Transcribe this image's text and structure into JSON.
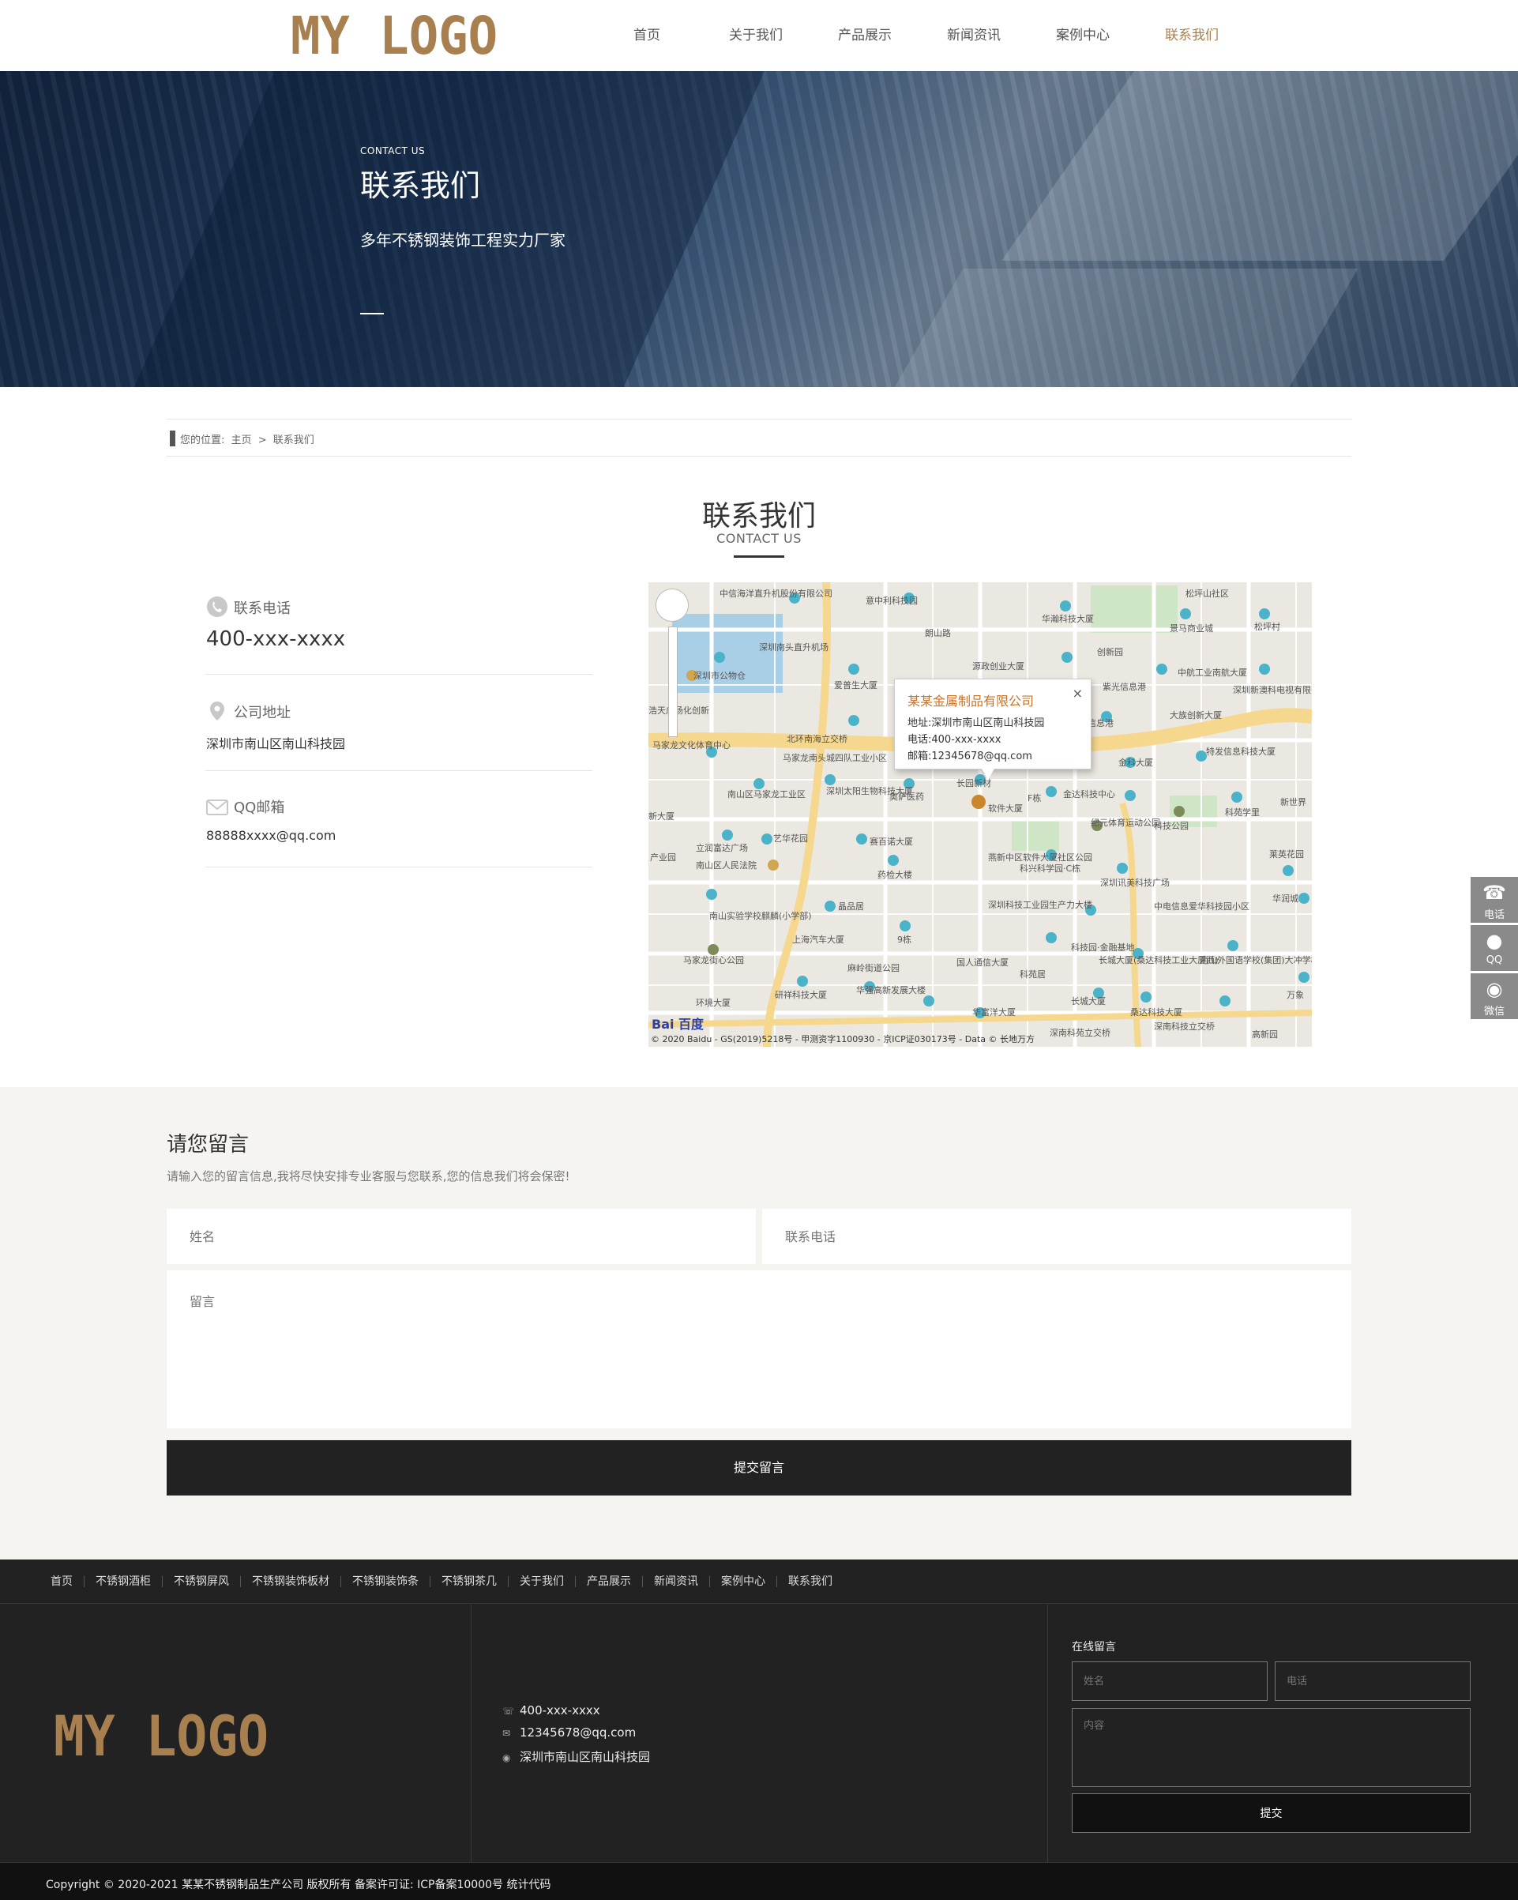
{
  "header": {
    "logo_text": "MY LOGO",
    "nav": [
      {
        "label": "首页"
      },
      {
        "label": "关于我们"
      },
      {
        "label": "产品展示"
      },
      {
        "label": "新闻资讯"
      },
      {
        "label": "案例中心"
      },
      {
        "label": "联系我们",
        "active": true
      }
    ]
  },
  "banner": {
    "en": "CONTACT US",
    "title": "联系我们",
    "subtitle": "多年不锈钢装饰工程实力厂家"
  },
  "breadcrumb": {
    "prefix": "您的位置:",
    "home": "主页",
    "sep": ">",
    "current": "联系我们"
  },
  "section": {
    "title": "联系我们",
    "en": "CONTACT US"
  },
  "contact": {
    "phone_label": "联系电话",
    "phone": "400-xxx-xxxx",
    "address_label": "公司地址",
    "address": "深圳市南山区南山科技园",
    "email_label": "QQ邮箱",
    "email": "88888xxxx@qq.com"
  },
  "map": {
    "popup_title": "某某金属制品有限公司",
    "popup_close": "×",
    "popup_address": "地址:深圳市南山区南山科技园",
    "popup_phone": "电话:400-xxx-xxxx",
    "popup_email": "邮箱:12345678@qq.com",
    "logo": "Bai 百度",
    "copyright": "© 2020 Baidu - GS(2019)5218号 - 甲测资字1100930 - 京ICP证030173号 - Data © 长地万方",
    "labels": [
      "中信海洋直升机股份有限公司",
      "意中利科技园",
      "华瀚科技大厦",
      "松坪山社区",
      "松坪村",
      "景马商业城",
      "深圳南头直升机场",
      "朗山路",
      "源政创业大厦",
      "创新园",
      "中航工业南航大厦",
      "深圳新澳科电视有限公司",
      "深圳市公物仓",
      "爱普生大厦",
      "紫光信息港",
      "浩天广场化创新",
      "大族创新大厦",
      "马家龙文化体育中心",
      "北环南海立交桥",
      "马家龙南头城四队工业小区",
      "华信息港",
      "金科大厦",
      "特发信息科技大厦",
      "南山区马家龙工业区",
      "深圳太阳生物科技大厦",
      "奥萨医药",
      "长园新材",
      "软件大厦",
      "F栋",
      "金达科技中心",
      "科技公园",
      "新世界",
      "纪元体育运动公园",
      "科苑学里",
      "艺华花园",
      "赛百诺大厦",
      "立润富达广场",
      "南山区人民法院",
      "药检大楼",
      "燕新中区软件大厦社区公园",
      "科兴科学园·C栋",
      "莱英花园",
      "深圳讯美科技广场",
      "华润城",
      "中电信息爱华科技园小区",
      "南山实验学校麒麟(小学部)",
      "晶品居",
      "深圳科技工业园生产力大楼",
      "上海汽车大厦",
      "9栋",
      "科技园·金融基地",
      "马家龙街心公园",
      "麻岭街道公园",
      "国人通信大厦",
      "长城大厦(桑达科技工业大厦西)",
      "南山外国语学校(集团)大冲学校",
      "万象",
      "科苑居",
      "研祥科技大厦",
      "华强高新发展大楼",
      "长城大厦",
      "环境大厦",
      "华富洋大厦",
      "桑达科技大厦",
      "深南科技立交桥",
      "深南科苑立交桥",
      "高新园",
      "产业园",
      "新大厦"
    ]
  },
  "message": {
    "title": "请您留言",
    "desc": "请输入您的留言信息,我将尽快安排专业客服与您联系,您的信息我们将会保密!",
    "name_placeholder": "姓名",
    "phone_placeholder": "联系电话",
    "message_placeholder": "留言",
    "submit_label": "提交留言"
  },
  "side": {
    "phone": "电话",
    "qq": "QQ",
    "wechat": "微信"
  },
  "footer": {
    "nav": [
      "首页",
      "不锈钢酒柜",
      "不锈钢屏风",
      "不锈钢装饰板材",
      "不锈钢装饰条",
      "不锈钢茶几",
      "关于我们",
      "产品展示",
      "新闻资讯",
      "案例中心",
      "联系我们"
    ],
    "logo_text": "MY LOGO",
    "phone": "400-xxx-xxxx",
    "email": "12345678@qq.com",
    "address": "深圳市南山区南山科技园",
    "form_title": "在线留言",
    "name_placeholder": "姓名",
    "phone_placeholder": "电话",
    "content_placeholder": "内容",
    "submit_label": "提交",
    "copyright": "Copyright © 2020-2021 某某不锈钢制品生产公司 版权所有  备案许可证: ICP备案10000号  统计代码"
  },
  "colors": {
    "accent": "#a88050",
    "dark": "#222222",
    "message_bg": "#f5f4f0"
  }
}
